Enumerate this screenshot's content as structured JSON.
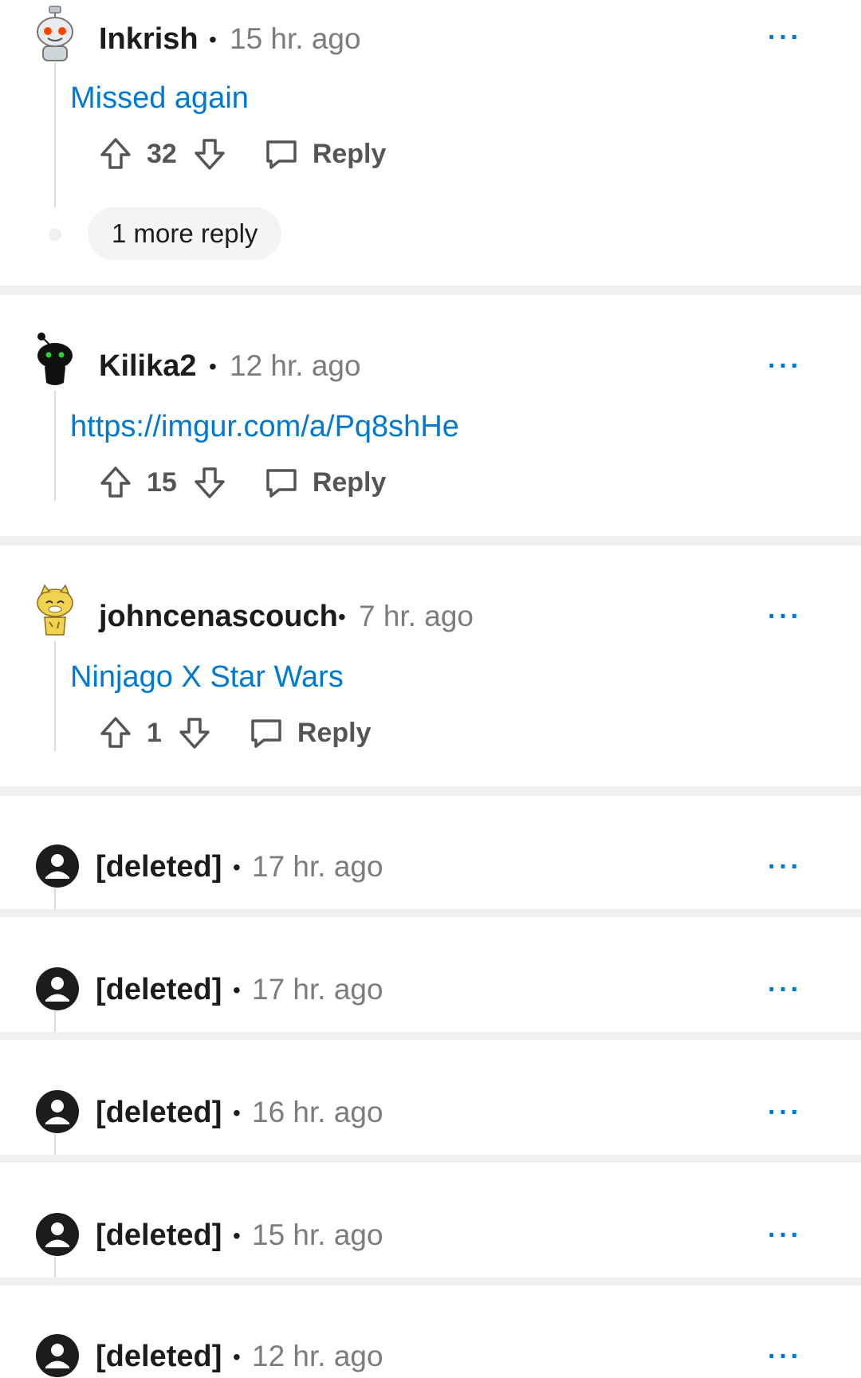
{
  "comments": [
    {
      "username": "Inkrish",
      "time": "15 hr. ago",
      "body": "Missed again",
      "score": "32",
      "reply_label": "Reply",
      "more_replies": "1 more reply",
      "more_label": "···"
    },
    {
      "username": "Kilika2",
      "time": "12 hr. ago",
      "body": "https://imgur.com/a/Pq8shHe",
      "score": "15",
      "reply_label": "Reply",
      "more_label": "···"
    },
    {
      "username": "johncenascouch",
      "time": "7 hr. ago",
      "body": "Ninjago X Star Wars",
      "score": "1",
      "reply_label": "Reply",
      "more_label": "···"
    }
  ],
  "deleted": [
    {
      "username": "[deleted]",
      "time": "17 hr. ago",
      "more_label": "···"
    },
    {
      "username": "[deleted]",
      "time": "17 hr. ago",
      "more_label": "···"
    },
    {
      "username": "[deleted]",
      "time": "16 hr. ago",
      "more_label": "···"
    },
    {
      "username": "[deleted]",
      "time": "15 hr. ago",
      "more_label": "···"
    },
    {
      "username": "[deleted]",
      "time": "12 hr. ago",
      "more_label": "···"
    }
  ],
  "meta_dot": "•",
  "colors": {
    "link": "#0079d3",
    "muted": "#7c7c7c",
    "separator": "#edeff1"
  }
}
